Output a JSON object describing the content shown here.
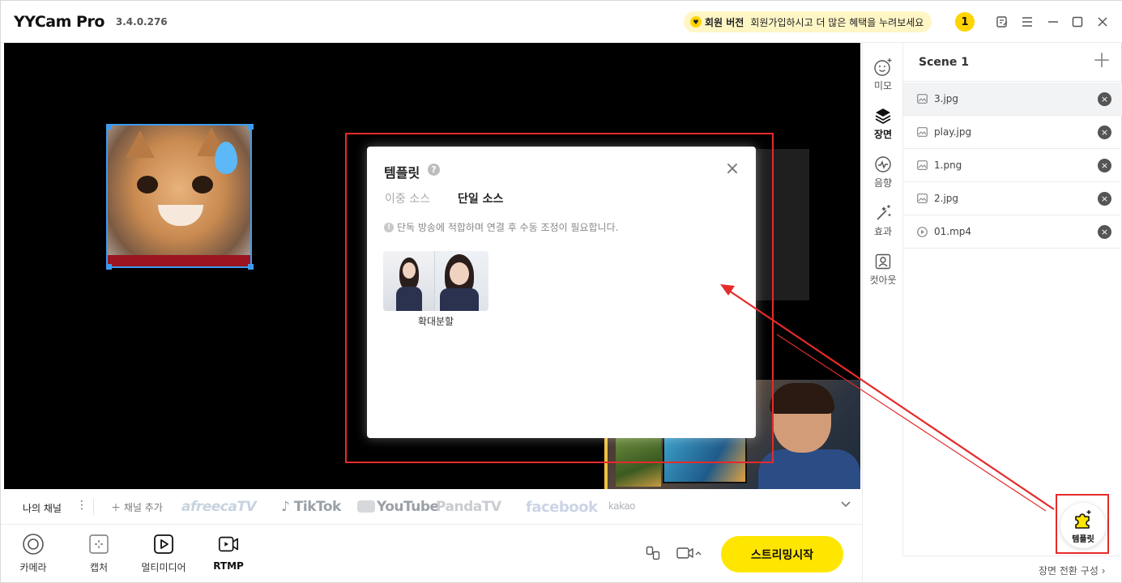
{
  "app": {
    "name": "YYCam Pro",
    "version": "3.4.0.276"
  },
  "promo": {
    "label": "회원 버전",
    "text": "회원가입하시고 더 많은 혜택을 누려보세요"
  },
  "notification_count": "1",
  "dialog": {
    "title": "템플릿",
    "help": "?",
    "tabs": [
      {
        "label": "이중 소스",
        "active": false
      },
      {
        "label": "단일 소스",
        "active": true
      }
    ],
    "info": "단독 방송에 적합하며 연결 후 수동 조정이 필요합니다.",
    "templates": [
      {
        "label": "확대분할"
      }
    ]
  },
  "channels": {
    "my_channel": "나의 채널",
    "add_channel": "채널 추가",
    "platforms": [
      "afreecaTV",
      "TikTok",
      "YouTube",
      "PandaTV",
      "facebook",
      "kakao"
    ]
  },
  "tools": [
    {
      "label": "카메라",
      "icon": "camera-icon"
    },
    {
      "label": "캡처",
      "icon": "capture-icon"
    },
    {
      "label": "멀티미디어",
      "icon": "multimedia-icon"
    },
    {
      "label": "RTMP",
      "icon": "rtmp-icon"
    }
  ],
  "stream_button": "스트리밍시작",
  "nav": [
    {
      "label": "미모",
      "icon": "face-icon",
      "active": false
    },
    {
      "label": "장면",
      "icon": "layers-icon",
      "active": true
    },
    {
      "label": "음향",
      "icon": "audio-icon",
      "active": false
    },
    {
      "label": "효과",
      "icon": "magic-wand-icon",
      "active": false
    },
    {
      "label": "컷아웃",
      "icon": "cutout-icon",
      "active": false
    }
  ],
  "scene": {
    "title": "Scene 1",
    "sources": [
      {
        "name": "3.jpg",
        "type": "image",
        "selected": true
      },
      {
        "name": "play.jpg",
        "type": "image",
        "selected": false
      },
      {
        "name": "1.png",
        "type": "image",
        "selected": false
      },
      {
        "name": "2.jpg",
        "type": "image",
        "selected": false
      },
      {
        "name": "01.mp4",
        "type": "video",
        "selected": false
      }
    ]
  },
  "template_fab": "템플릿",
  "scene_transition": "장면 전환 구성",
  "colors": {
    "accent": "#ffe600",
    "highlight": "#e52b2b",
    "selection": "#3d9cf0"
  }
}
